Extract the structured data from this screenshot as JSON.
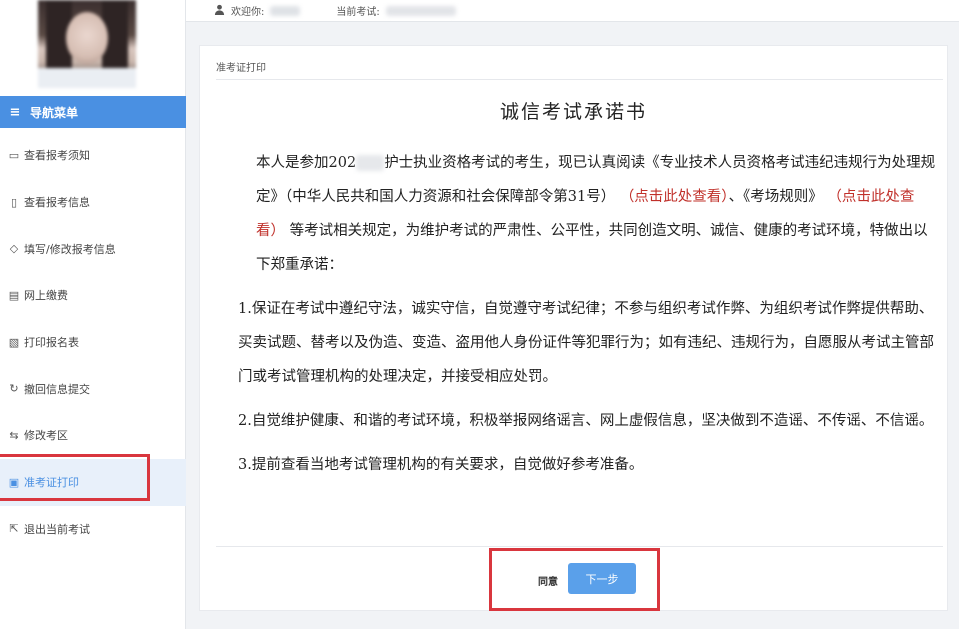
{
  "topbar": {
    "user_icon": "user-icon",
    "welcome_label": "欢迎你:",
    "exam_label": "当前考试:"
  },
  "sidebar": {
    "header_icon": "≡",
    "header_label": "导航菜单",
    "items": [
      {
        "icon": "▭",
        "label": "查看报考须知"
      },
      {
        "icon": "▯",
        "label": "查看报考信息"
      },
      {
        "icon": "◇",
        "label": "填写/修改报考信息"
      },
      {
        "icon": "▤",
        "label": "网上缴费"
      },
      {
        "icon": "▧",
        "label": "打印报名表"
      },
      {
        "icon": "↻",
        "label": "撤回信息提交"
      },
      {
        "icon": "⇆",
        "label": "修改考区"
      },
      {
        "icon": "▣",
        "label": "准考证打印"
      },
      {
        "icon": "⇱",
        "label": "退出当前考试"
      }
    ],
    "active_index": 7
  },
  "panel": {
    "title": "准考证打印",
    "doc_title": "诚信考试承诺书",
    "intro_part1": "本人是参加202",
    "intro_part2": "护士执业资格考试的考生，现已认真阅读《专业技术人员资格考试违纪违规行为处理规定》（中华人民共和国人力资源和社会保障部令第31号）",
    "link1": "（点击此处查看）",
    "intro_part3": "、《考场规则》",
    "link2": "（点击此处查看）",
    "intro_part4": "等考试相关规定，为维护考试的严肃性、公平性，共同创造文明、诚信、健康的考试环境，特做出以下郑重承诺：",
    "item1": "1.保证在考试中遵纪守法，诚实守信，自觉遵守考试纪律；不参与组织考试作弊、为组织考试作弊提供帮助、买卖试题、替考以及伪造、变造、盗用他人身份证件等犯罪行为；如有违纪、违规行为，自愿服从考试主管部门或考试管理机构的处理决定，并接受相应处罚。",
    "item2": "2.自觉维护健康、和谐的考试环境，积极举报网络谣言、网上虚假信息，坚决做到不造谣、不传谣、不信谣。",
    "item3": "3.提前查看当地考试管理机构的有关要求，自觉做好参考准备。",
    "agree_label": "同意",
    "next_label": "下一步"
  },
  "colors": {
    "accent": "#4a90e2",
    "link_red": "#c0302a",
    "highlight_box": "#d9363e"
  }
}
